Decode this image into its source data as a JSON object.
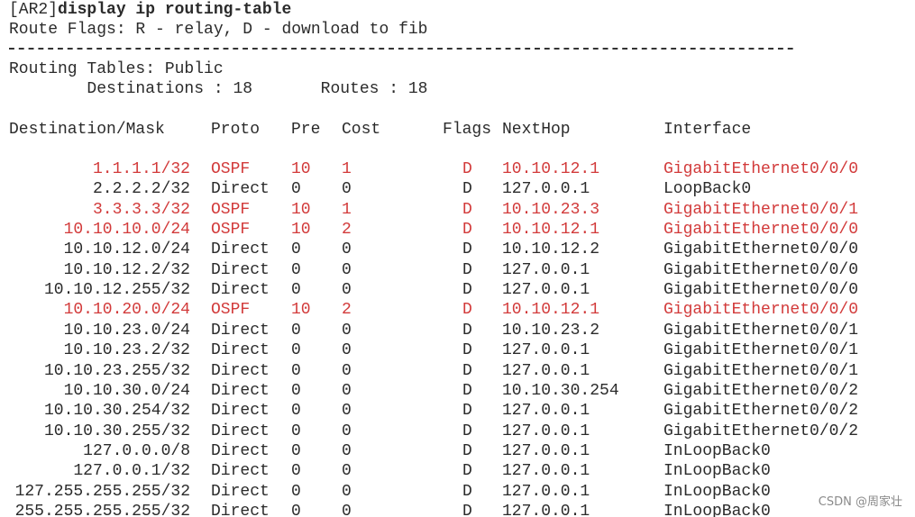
{
  "terminal": {
    "prompt": "[AR2]",
    "command": "display ip routing-table",
    "flags_legend": "Route Flags: R - relay, D - download to fib",
    "tables_label": "Routing Tables: Public",
    "summary": "        Destinations : 18       Routes : 18",
    "columns": {
      "destination": "Destination/Mask",
      "proto": "Proto",
      "pre": "Pre",
      "cost": "Cost",
      "flags": "Flags",
      "nexthop": "NextHop",
      "interface": "Interface"
    },
    "rows": [
      {
        "dest": "1.1.1.1/32",
        "proto": "OSPF",
        "pre": "10",
        "cost": "1",
        "flags": "D",
        "nexthop": "10.10.12.1",
        "iface": "GigabitEthernet0/0/0",
        "highlight": true
      },
      {
        "dest": "2.2.2.2/32",
        "proto": "Direct",
        "pre": "0",
        "cost": "0",
        "flags": "D",
        "nexthop": "127.0.0.1",
        "iface": "LoopBack0",
        "highlight": false
      },
      {
        "dest": "3.3.3.3/32",
        "proto": "OSPF",
        "pre": "10",
        "cost": "1",
        "flags": "D",
        "nexthop": "10.10.23.3",
        "iface": "GigabitEthernet0/0/1",
        "highlight": true
      },
      {
        "dest": "10.10.10.0/24",
        "proto": "OSPF",
        "pre": "10",
        "cost": "2",
        "flags": "D",
        "nexthop": "10.10.12.1",
        "iface": "GigabitEthernet0/0/0",
        "highlight": true
      },
      {
        "dest": "10.10.12.0/24",
        "proto": "Direct",
        "pre": "0",
        "cost": "0",
        "flags": "D",
        "nexthop": "10.10.12.2",
        "iface": "GigabitEthernet0/0/0",
        "highlight": false
      },
      {
        "dest": "10.10.12.2/32",
        "proto": "Direct",
        "pre": "0",
        "cost": "0",
        "flags": "D",
        "nexthop": "127.0.0.1",
        "iface": "GigabitEthernet0/0/0",
        "highlight": false
      },
      {
        "dest": "10.10.12.255/32",
        "proto": "Direct",
        "pre": "0",
        "cost": "0",
        "flags": "D",
        "nexthop": "127.0.0.1",
        "iface": "GigabitEthernet0/0/0",
        "highlight": false
      },
      {
        "dest": "10.10.20.0/24",
        "proto": "OSPF",
        "pre": "10",
        "cost": "2",
        "flags": "D",
        "nexthop": "10.10.12.1",
        "iface": "GigabitEthernet0/0/0",
        "highlight": true
      },
      {
        "dest": "10.10.23.0/24",
        "proto": "Direct",
        "pre": "0",
        "cost": "0",
        "flags": "D",
        "nexthop": "10.10.23.2",
        "iface": "GigabitEthernet0/0/1",
        "highlight": false
      },
      {
        "dest": "10.10.23.2/32",
        "proto": "Direct",
        "pre": "0",
        "cost": "0",
        "flags": "D",
        "nexthop": "127.0.0.1",
        "iface": "GigabitEthernet0/0/1",
        "highlight": false
      },
      {
        "dest": "10.10.23.255/32",
        "proto": "Direct",
        "pre": "0",
        "cost": "0",
        "flags": "D",
        "nexthop": "127.0.0.1",
        "iface": "GigabitEthernet0/0/1",
        "highlight": false
      },
      {
        "dest": "10.10.30.0/24",
        "proto": "Direct",
        "pre": "0",
        "cost": "0",
        "flags": "D",
        "nexthop": "10.10.30.254",
        "iface": "GigabitEthernet0/0/2",
        "highlight": false
      },
      {
        "dest": "10.10.30.254/32",
        "proto": "Direct",
        "pre": "0",
        "cost": "0",
        "flags": "D",
        "nexthop": "127.0.0.1",
        "iface": "GigabitEthernet0/0/2",
        "highlight": false
      },
      {
        "dest": "10.10.30.255/32",
        "proto": "Direct",
        "pre": "0",
        "cost": "0",
        "flags": "D",
        "nexthop": "127.0.0.1",
        "iface": "GigabitEthernet0/0/2",
        "highlight": false
      },
      {
        "dest": "127.0.0.0/8",
        "proto": "Direct",
        "pre": "0",
        "cost": "0",
        "flags": "D",
        "nexthop": "127.0.0.1",
        "iface": "InLoopBack0",
        "highlight": false
      },
      {
        "dest": "127.0.0.1/32",
        "proto": "Direct",
        "pre": "0",
        "cost": "0",
        "flags": "D",
        "nexthop": "127.0.0.1",
        "iface": "InLoopBack0",
        "highlight": false
      },
      {
        "dest": "127.255.255.255/32",
        "proto": "Direct",
        "pre": "0",
        "cost": "0",
        "flags": "D",
        "nexthop": "127.0.0.1",
        "iface": "InLoopBack0",
        "highlight": false
      },
      {
        "dest": "255.255.255.255/32",
        "proto": "Direct",
        "pre": "0",
        "cost": "0",
        "flags": "D",
        "nexthop": "127.0.0.1",
        "iface": "InLoopBack0",
        "highlight": false
      }
    ]
  },
  "watermark": "CSDN @周家壮",
  "colors": {
    "text": "#2b2b2b",
    "highlight": "#d23a3a",
    "background": "#ffffff"
  }
}
